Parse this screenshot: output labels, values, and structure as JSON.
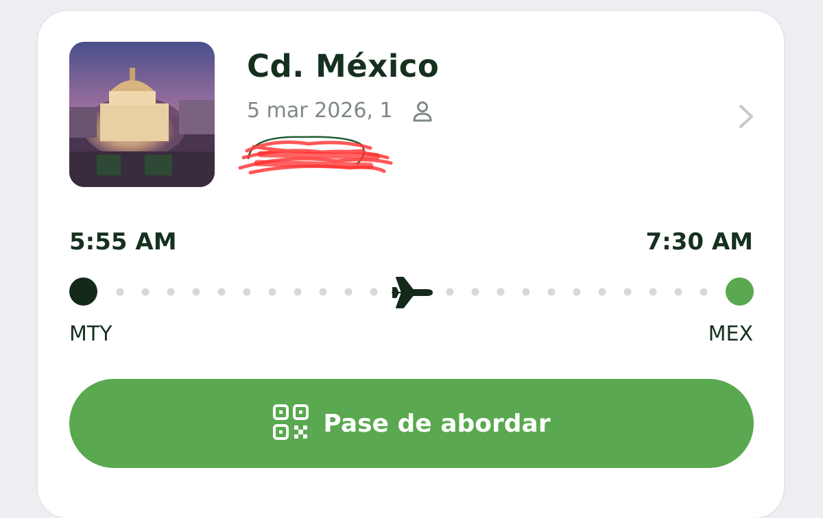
{
  "trip": {
    "destination": "Cd. México",
    "date_pax": "5 mar 2026, 1",
    "departure_time": "5:55 AM",
    "arrival_time": "7:30 AM",
    "origin_code": "MTY",
    "destination_code": "MEX"
  },
  "actions": {
    "boarding_pass_label": "Pase de abordar"
  },
  "icons": {
    "passenger": "person-icon",
    "chevron": "chevron-right-icon",
    "plane": "airplane-icon",
    "qr": "qr-code-icon"
  },
  "colors": {
    "accent_green": "#5aa84f",
    "dark_green": "#15291b",
    "background": "#ededf2"
  }
}
